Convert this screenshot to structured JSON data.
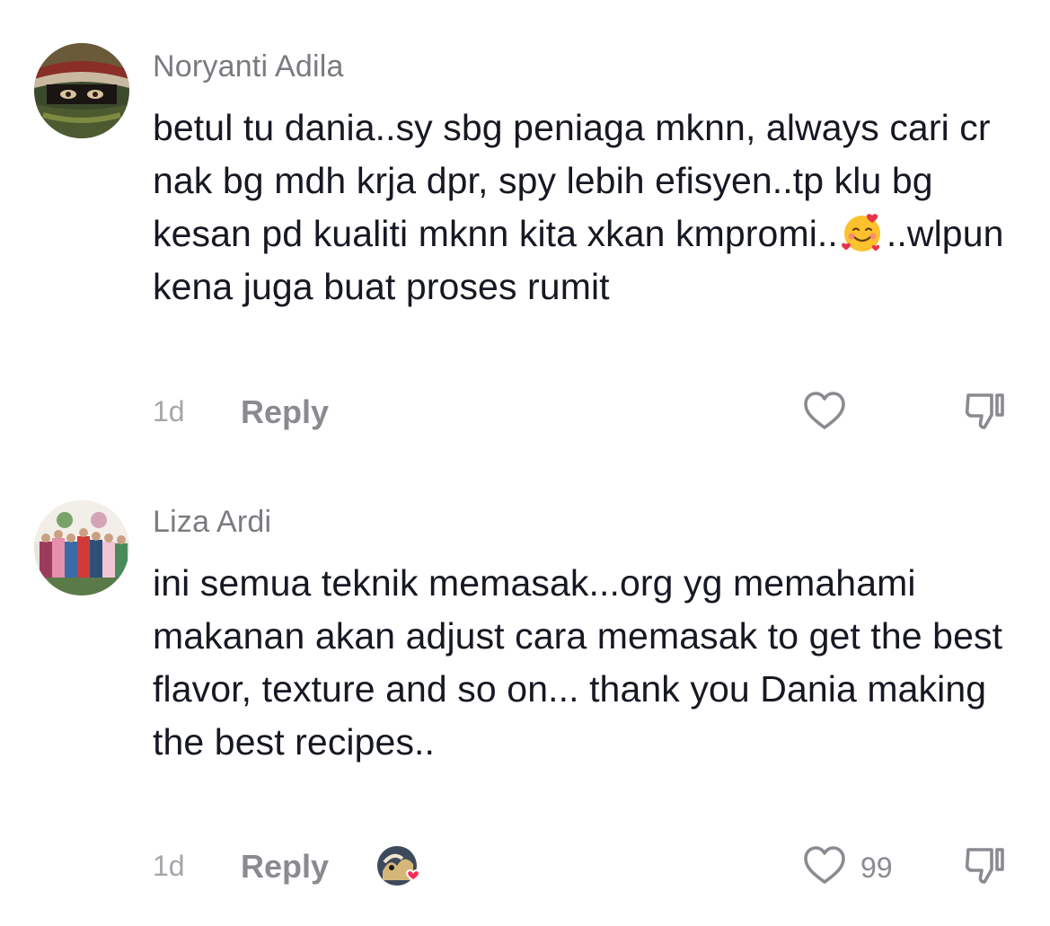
{
  "comments": [
    {
      "username": "Noryanti Adila",
      "text_before_emoji": "betul tu dania..sy sbg peniaga mknn, always cari cr nak bg mdh krja dpr, spy lebih efisyen..tp klu bg kesan pd kualiti mknn kita xkan kmpromi..",
      "emoji": "smiling-face-with-hearts",
      "text_after_emoji": "..wlpun kena juga buat proses rumit",
      "time": "1d",
      "reply_label": "Reply",
      "like_count": ""
    },
    {
      "username": "Liza Ardi",
      "text": "ini semua teknik memasak...org yg memahami makanan akan adjust cara memasak to get the best flavor, texture and so on... thank you Dania making the best recipes..",
      "time": "1d",
      "reply_label": "Reply",
      "like_count": "99"
    }
  ],
  "icons": {
    "like": "heart-outline-icon",
    "dislike": "thumbs-down-icon",
    "creator_like": "creator-liked-badge"
  },
  "colors": {
    "text": "#161823",
    "username": "#7a7b80",
    "muted": "#a5a6aa",
    "reply": "#8a8b91",
    "heart_badge": "#fe2c55"
  }
}
